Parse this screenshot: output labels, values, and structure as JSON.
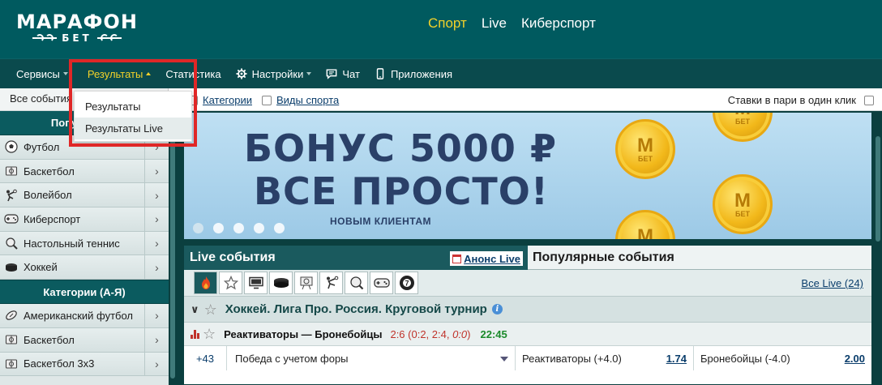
{
  "brand": {
    "name_main": "МАРАФОН",
    "name_sub": "БЕТ"
  },
  "top_nav": [
    {
      "label": "Спорт",
      "active": true
    },
    {
      "label": "Live",
      "active": false
    },
    {
      "label": "Киберспорт",
      "active": false
    }
  ],
  "sub_nav": {
    "services": "Сервисы",
    "results": "Результаты",
    "statistics": "Статистика",
    "settings": "Настройки",
    "chat": "Чат",
    "apps": "Приложения"
  },
  "results_dropdown": {
    "items": [
      "Результаты",
      "Результаты Live"
    ],
    "hovered_index": 1
  },
  "toolbar": {
    "all_events": "Все события",
    "filters": [
      "Категории",
      "Виды спорта"
    ],
    "one_click": "Ставки в пари в один клик"
  },
  "sidebar": {
    "popular_heading": "Популярные",
    "popular_items": [
      "Футбол",
      "Баскетбол",
      "Волейбол",
      "Киберспорт",
      "Настольный теннис",
      "Хоккей"
    ],
    "categories_heading": "Категории (А-Я)",
    "category_items": [
      "Американский футбол",
      "Баскетбол",
      "Баскетбол 3х3"
    ]
  },
  "banner": {
    "line1": "БОНУС 5000 ₽",
    "line2": "ВСЕ ПРОСТО!",
    "line3": "НОВЫМ КЛИЕНТАМ",
    "coin_letter": "М",
    "coin_sub": "БЕТ",
    "slide_count": 5,
    "active_slide": 0
  },
  "live_panel": {
    "tab_live": "Live события",
    "anons_link": "Анонс Live",
    "tab_popular": "Популярные события",
    "all_live_link": "Все Live (24)",
    "sport_icons": [
      "fire-icon",
      "star-icon",
      "monitor-icon",
      "hockey-puck-icon",
      "volleyball-icon",
      "kick-icon",
      "ping-pong-icon",
      "gamepad-icon",
      "billiard-ball-icon"
    ],
    "billiard_number": "7",
    "league": "Хоккей. Лига Про. Россия. Круговой турнир",
    "match": {
      "teams": "Реактиваторы — Бронебойцы",
      "score_main": "2:6",
      "score_open": " (0:2, 2:4, ",
      "score_current": "0:0",
      "score_close": ")",
      "time": "22:45"
    },
    "odds": {
      "more": "+43",
      "market": "Победа с учетом форы",
      "outcome1_label": "Реактиваторы (+4.0)",
      "outcome1_price": "1.74",
      "outcome2_label": "Бронебойцы (-4.0)",
      "outcome2_price": "2.00"
    }
  },
  "colors": {
    "header_bg": "#005a5f",
    "accent_yellow": "#f2d12a",
    "highlight_red": "#e02727",
    "link_blue": "#0a3d6b"
  }
}
